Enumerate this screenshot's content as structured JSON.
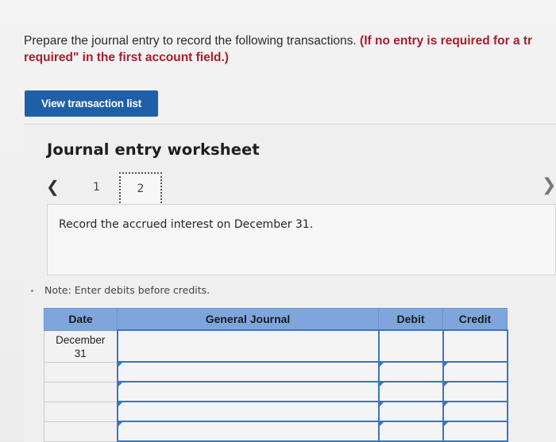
{
  "instructions": {
    "text": "Prepare the journal entry to record the following transactions. ",
    "hint_line1": "(If no entry is required for a tr",
    "hint_line2": "required\" in the first account field.)"
  },
  "view_transaction_button": "View transaction list",
  "worksheet": {
    "title": "Journal entry worksheet",
    "steps": [
      "1",
      "2"
    ],
    "current_step": "2",
    "prompt": "Record the accrued interest on December 31.",
    "note": "Note: Enter debits before credits."
  },
  "table": {
    "headers": {
      "date": "Date",
      "journal": "General Journal",
      "debit": "Debit",
      "credit": "Credit"
    },
    "rows": [
      {
        "date": "December\n31",
        "journal": "",
        "debit": "",
        "credit": ""
      },
      {
        "date": "",
        "journal": "",
        "debit": "",
        "credit": ""
      },
      {
        "date": "",
        "journal": "",
        "debit": "",
        "credit": ""
      },
      {
        "date": "",
        "journal": "",
        "debit": "",
        "credit": ""
      },
      {
        "date": "",
        "journal": "",
        "debit": "",
        "credit": ""
      }
    ]
  },
  "colors": {
    "button": "#1f5fa8",
    "header": "#7ea6dd",
    "hint": "#a61e2e",
    "cell_border": "#3a75c4"
  },
  "icons": {
    "prev": "chevron-left-icon",
    "next": "chevron-right-icon"
  }
}
